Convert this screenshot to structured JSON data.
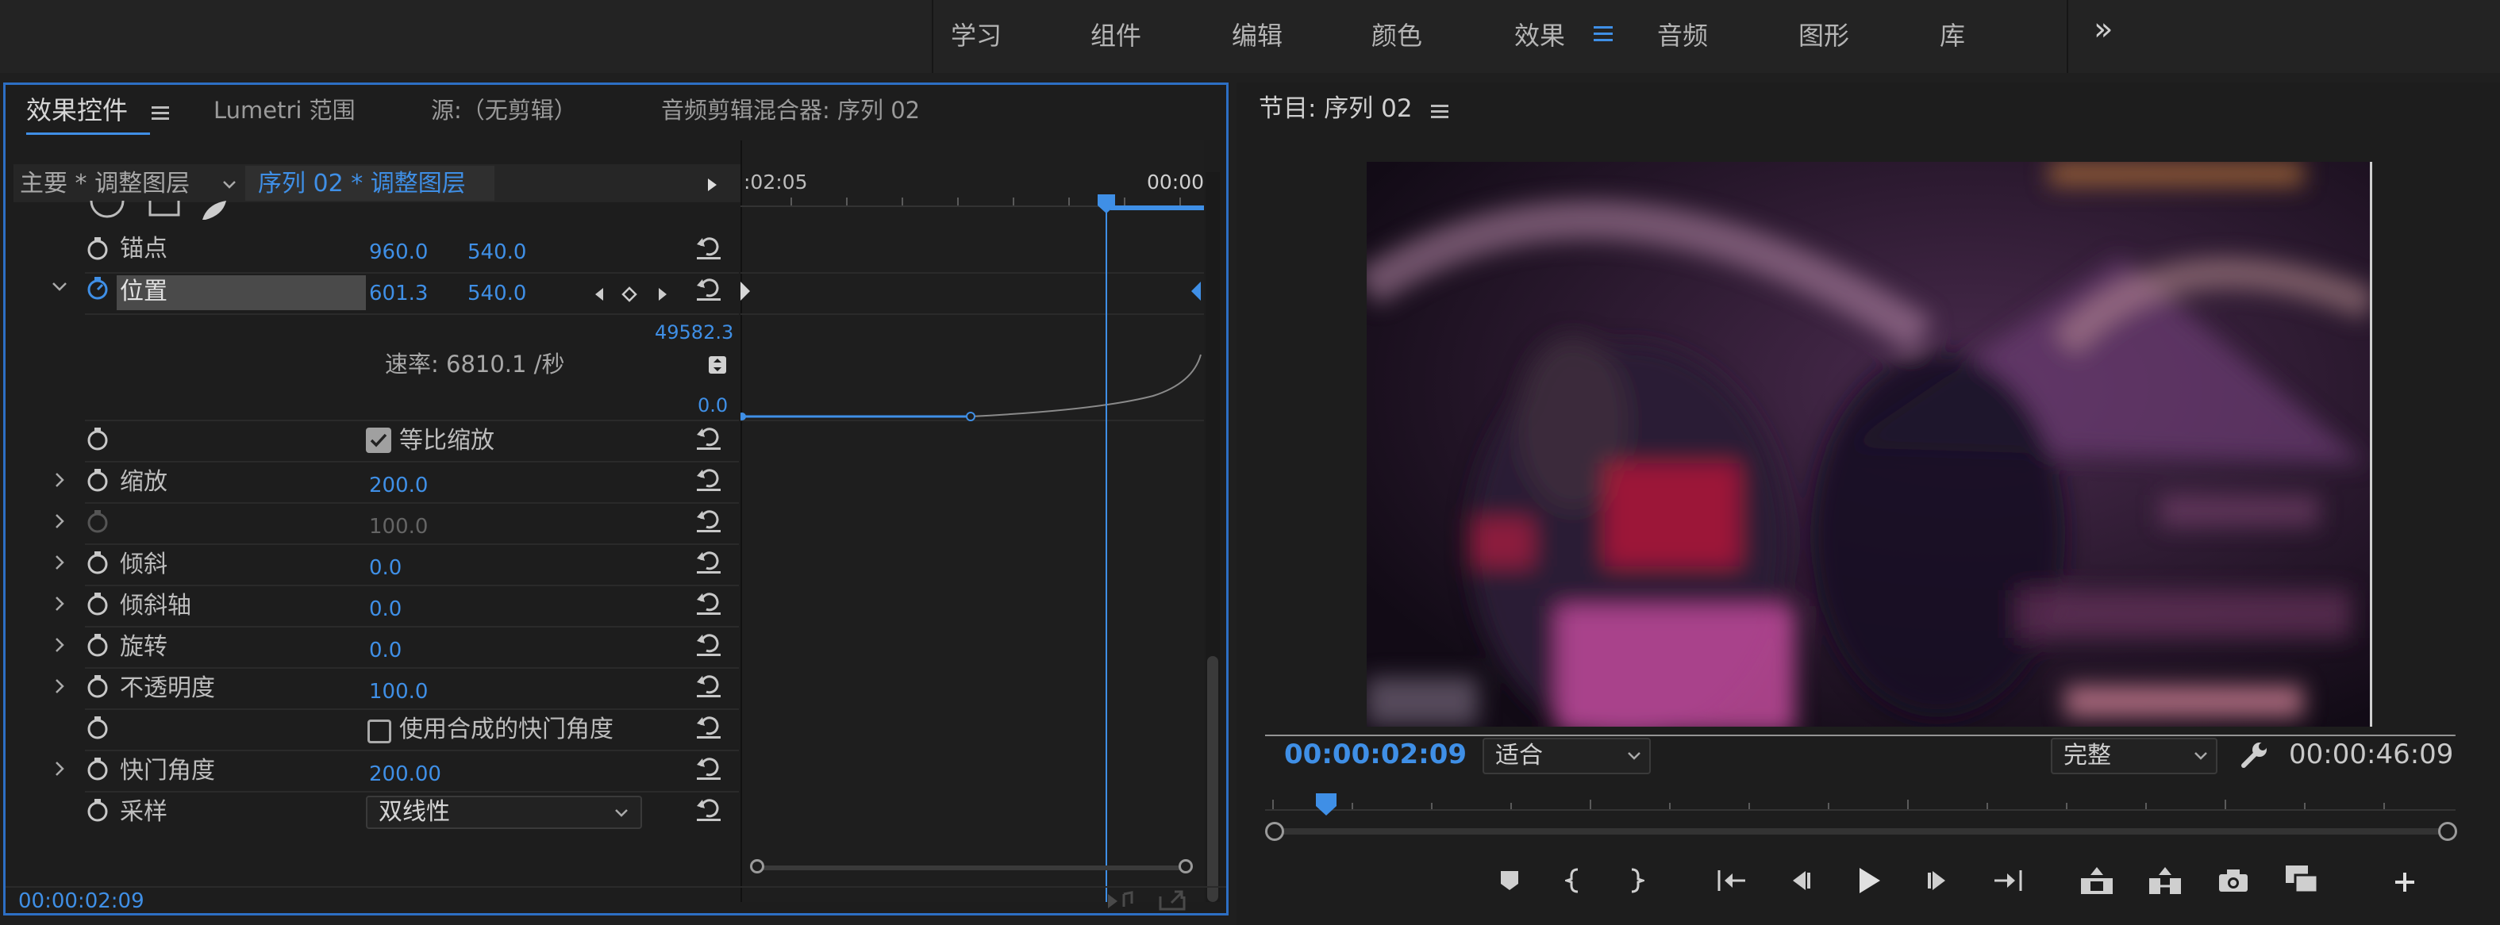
{
  "workspaces": {
    "items": [
      "学习",
      "组件",
      "编辑",
      "颜色",
      "效果",
      "音频",
      "图形",
      "库"
    ],
    "active_index": 4,
    "more_label": "»"
  },
  "effect_controls": {
    "tabs": [
      "效果控件",
      "Lumetri 范围",
      "源:（无剪辑）",
      "音频剪辑混合器: 序列 02"
    ],
    "master_clip": "主要 * 调整图层",
    "sequence_clip": "序列 02 * 调整图层",
    "timeline_time_left": ":02:05",
    "timeline_time_right": "00:00",
    "properties": {
      "anchor": {
        "label": "锚点",
        "x": "960.0",
        "y": "540.0"
      },
      "position": {
        "label": "位置",
        "x": "601.3",
        "y": "540.0"
      },
      "graph": {
        "max": "49582.3",
        "min": "0.0",
        "velocity": "速率: 6810.1 /秒"
      },
      "uniform_scale": {
        "label": "等比缩放",
        "checked": true
      },
      "scale": {
        "label": "缩放",
        "value": "200.0"
      },
      "scale_width": {
        "value": "100.0"
      },
      "skew": {
        "label": "倾斜",
        "value": "0.0"
      },
      "skew_axis": {
        "label": "倾斜轴",
        "value": "0.0"
      },
      "rotation": {
        "label": "旋转",
        "value": "0.0"
      },
      "opacity": {
        "label": "不透明度",
        "value": "100.0"
      },
      "comp_shutter": {
        "label": "使用合成的快门角度",
        "checked": false
      },
      "shutter_angle": {
        "label": "快门角度",
        "value": "200.00"
      },
      "sampling": {
        "label": "采样",
        "value": "双线性"
      }
    },
    "timecode": "00:00:02:09",
    "keyframe_position_fraction": 0.37
  },
  "program_monitor": {
    "title": "节目: 序列 02",
    "current_time": "00:00:02:09",
    "fit": "适合",
    "quality": "完整",
    "duration": "00:00:46:09",
    "playhead_fraction": 0.05
  },
  "colors": {
    "accent": "#3f8fe6",
    "panel_border": "#2d6fc4"
  }
}
